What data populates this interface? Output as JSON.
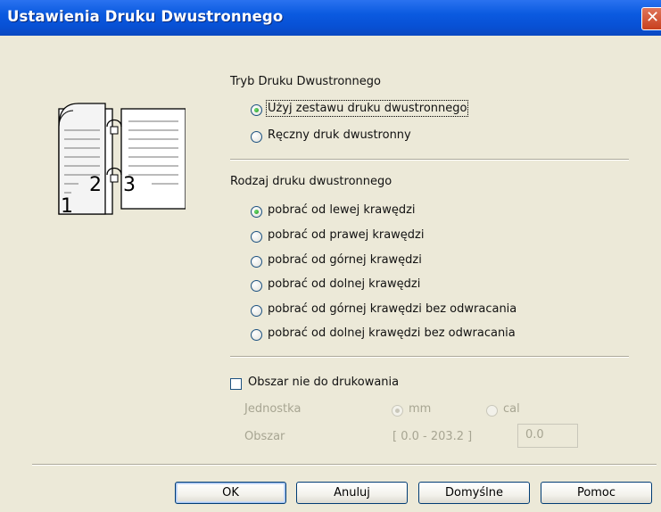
{
  "window": {
    "title": "Ustawienia Druku Dwustronnego"
  },
  "illustration": {
    "page_numbers": [
      "1",
      "2",
      "3"
    ]
  },
  "duplex_mode": {
    "heading": "Tryb Druku Dwustronnego",
    "options": [
      {
        "label": "Użyj zestawu druku dwustronnego",
        "selected": true
      },
      {
        "label": "Ręczny druk dwustronny",
        "selected": false
      }
    ]
  },
  "duplex_type": {
    "heading": "Rodzaj druku dwustronnego",
    "options": [
      {
        "label": "pobrać od lewej krawędzi",
        "selected": true
      },
      {
        "label": "pobrać od prawej krawędzi",
        "selected": false
      },
      {
        "label": "pobrać od górnej krawędzi",
        "selected": false
      },
      {
        "label": "pobrać od dolnej krawędzi",
        "selected": false
      },
      {
        "label": "pobrać od górnej krawędzi bez odwracania",
        "selected": false
      },
      {
        "label": "pobrać od dolnej krawędzi bez odwracania",
        "selected": false
      }
    ]
  },
  "no_print_area": {
    "checkbox_label": "Obszar nie do drukowania",
    "checked": false,
    "unit_label": "Jednostka",
    "unit_options": [
      {
        "label": "mm",
        "selected": true
      },
      {
        "label": "cal",
        "selected": false
      }
    ],
    "area_label": "Obszar",
    "range_text": "[ 0.0 - 203.2 ]",
    "area_value": "0.0"
  },
  "buttons": {
    "ok": "OK",
    "cancel": "Anuluj",
    "defaults": "Domyślne",
    "help": "Pomoc"
  }
}
